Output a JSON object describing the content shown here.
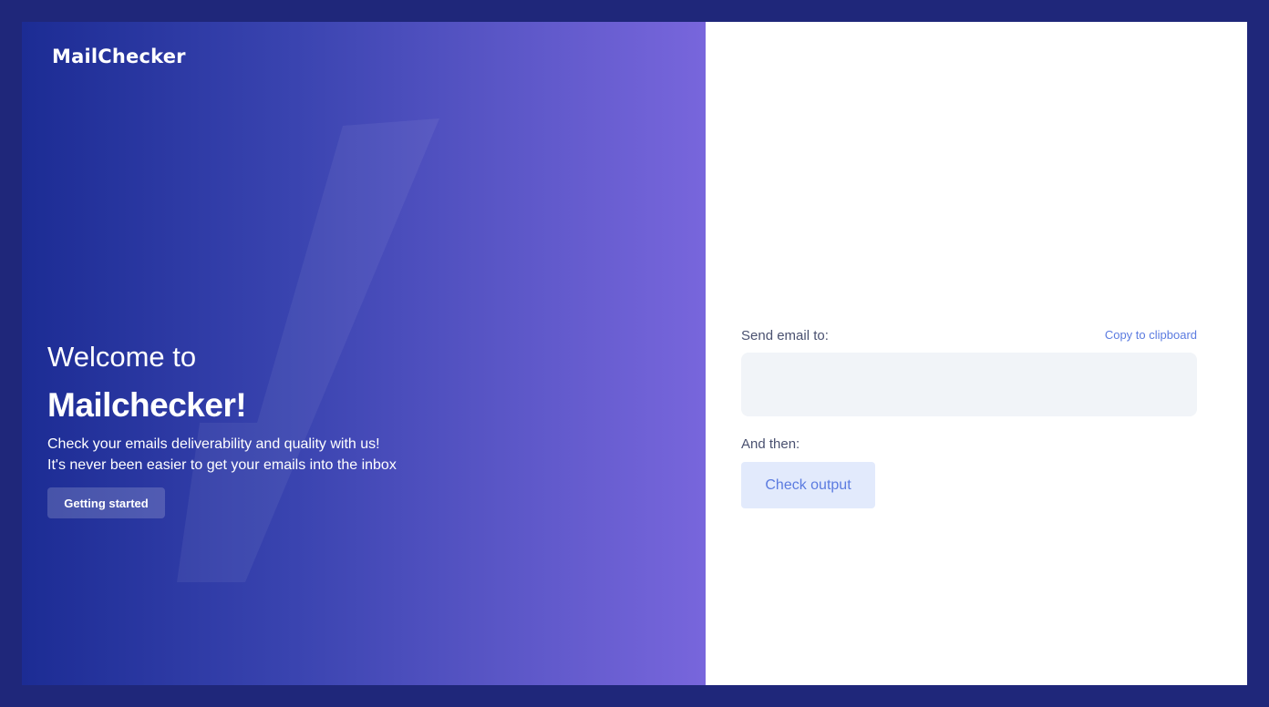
{
  "brand": {
    "name": "MailChecker"
  },
  "hero": {
    "welcome": "Welcome to",
    "product": "Mailchecker!",
    "line1": "Check your emails deliverability and quality with us!",
    "line2": "It's never been easier to get your emails into the inbox",
    "cta_label": "Getting started",
    "watermark_icon": "checkmark-icon"
  },
  "panel": {
    "send_label": "Send email to:",
    "copy_label": "Copy to clipboard",
    "email_value": "",
    "then_label": "And then:",
    "check_label": "Check output"
  },
  "colors": {
    "page_background": "#1f277a",
    "gradient_start": "#1c2c94",
    "gradient_end": "#7866dc",
    "accent": "#5b7be0",
    "field_background": "#f1f4f8",
    "button_background": "#e2eafc"
  }
}
